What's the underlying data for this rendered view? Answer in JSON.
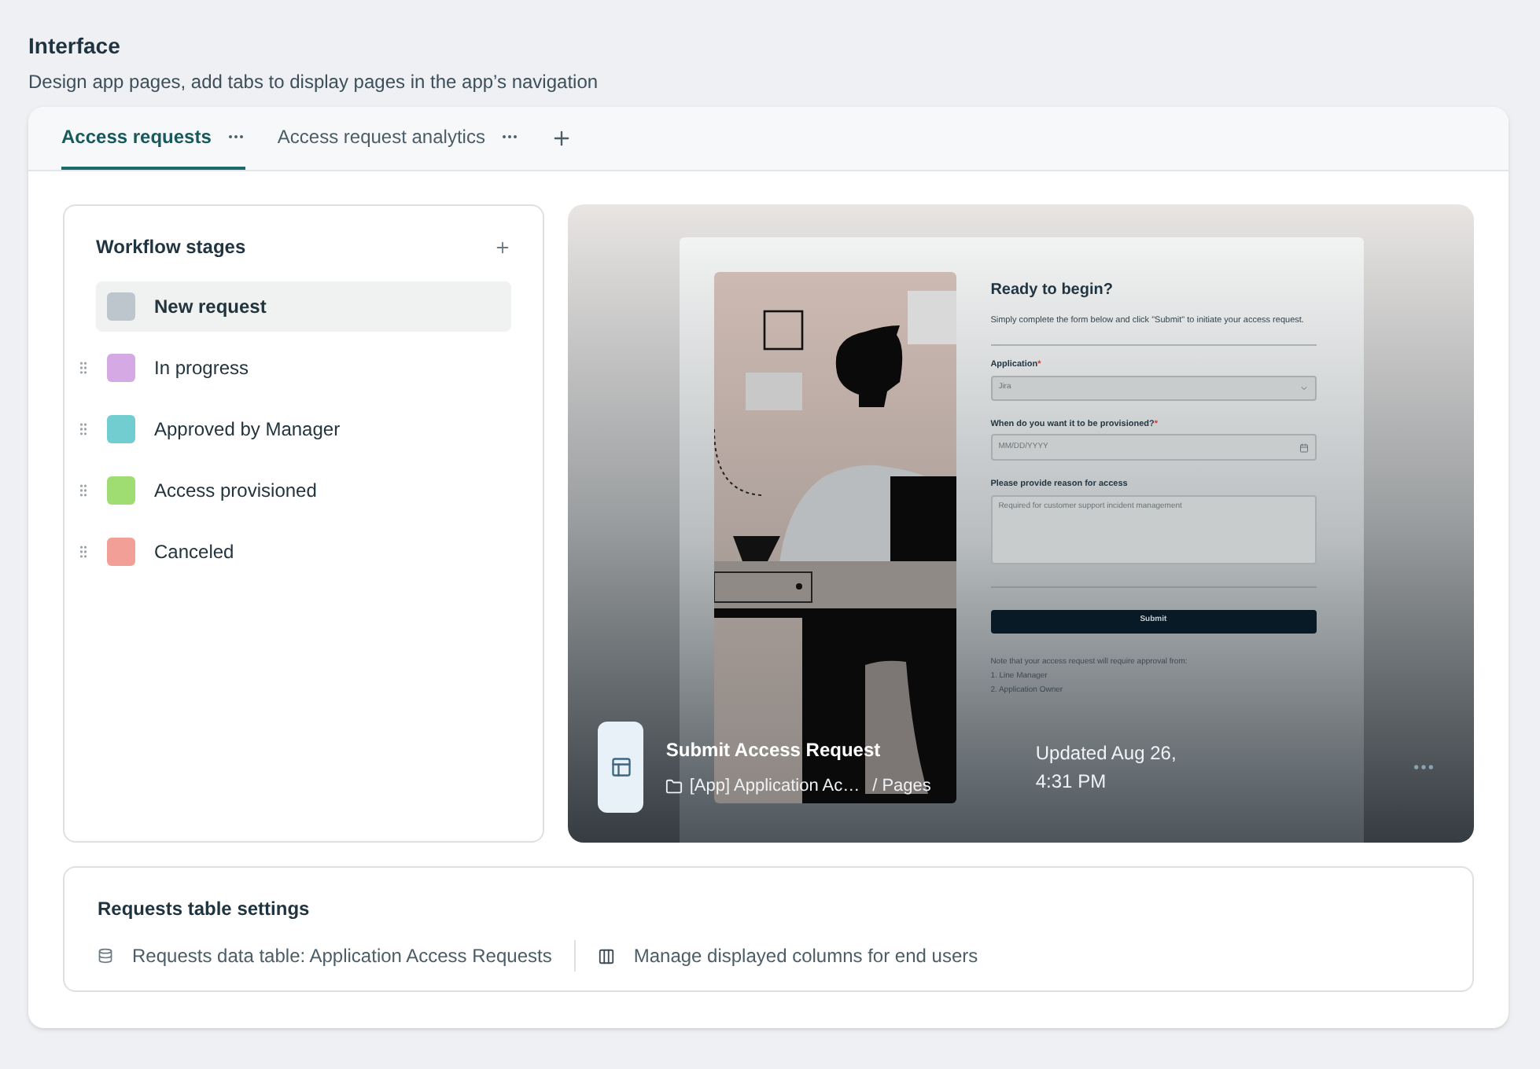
{
  "header": {
    "title": "Interface",
    "subtitle": "Design app pages, add tabs to display pages in the app’s navigation"
  },
  "tabs": [
    {
      "label": "Access requests",
      "selected": true
    },
    {
      "label": "Access request analytics",
      "selected": false
    }
  ],
  "stages": {
    "title": "Workflow stages",
    "items": [
      {
        "name": "New request",
        "color": "#bdc6cc",
        "selected": true,
        "draggable": false
      },
      {
        "name": "In progress",
        "color": "#d4a9e4",
        "selected": false,
        "draggable": true
      },
      {
        "name": "Approved by Manager",
        "color": "#72cdd0",
        "selected": false,
        "draggable": true
      },
      {
        "name": "Access provisioned",
        "color": "#9fdc72",
        "selected": false,
        "draggable": true
      },
      {
        "name": "Canceled",
        "color": "#f2a097",
        "selected": false,
        "draggable": true
      }
    ]
  },
  "preview": {
    "page": {
      "heading": "Ready to begin?",
      "intro": "Simply complete the form below and click \"Submit\" to initiate your access request.",
      "fields": [
        {
          "kind": "select",
          "label": "Application",
          "required_mark": "*",
          "value": "Jira"
        },
        {
          "kind": "date",
          "label": "When do you want it to be provisioned?",
          "required_mark": "*",
          "placeholder": "MM/DD/YYYY"
        },
        {
          "kind": "textarea",
          "label": "Please provide reason for access",
          "placeholder": "Required for customer support incident management"
        }
      ],
      "button": "Submit",
      "note": [
        "Note that your access request will require approval from:",
        "1. Line Manager",
        "2. Application Owner"
      ]
    },
    "title": "Submit Access Request",
    "folder": "[App] Application Ac…",
    "path_suffix": "/ Pages",
    "updated": "Updated Aug 26, 4:31 PM"
  },
  "settings": {
    "title": "Requests table settings",
    "links": [
      {
        "kind": "table",
        "label": "Requests data table: Application Access Requests"
      },
      {
        "kind": "columns",
        "label": "Manage displayed columns for end users"
      }
    ]
  }
}
